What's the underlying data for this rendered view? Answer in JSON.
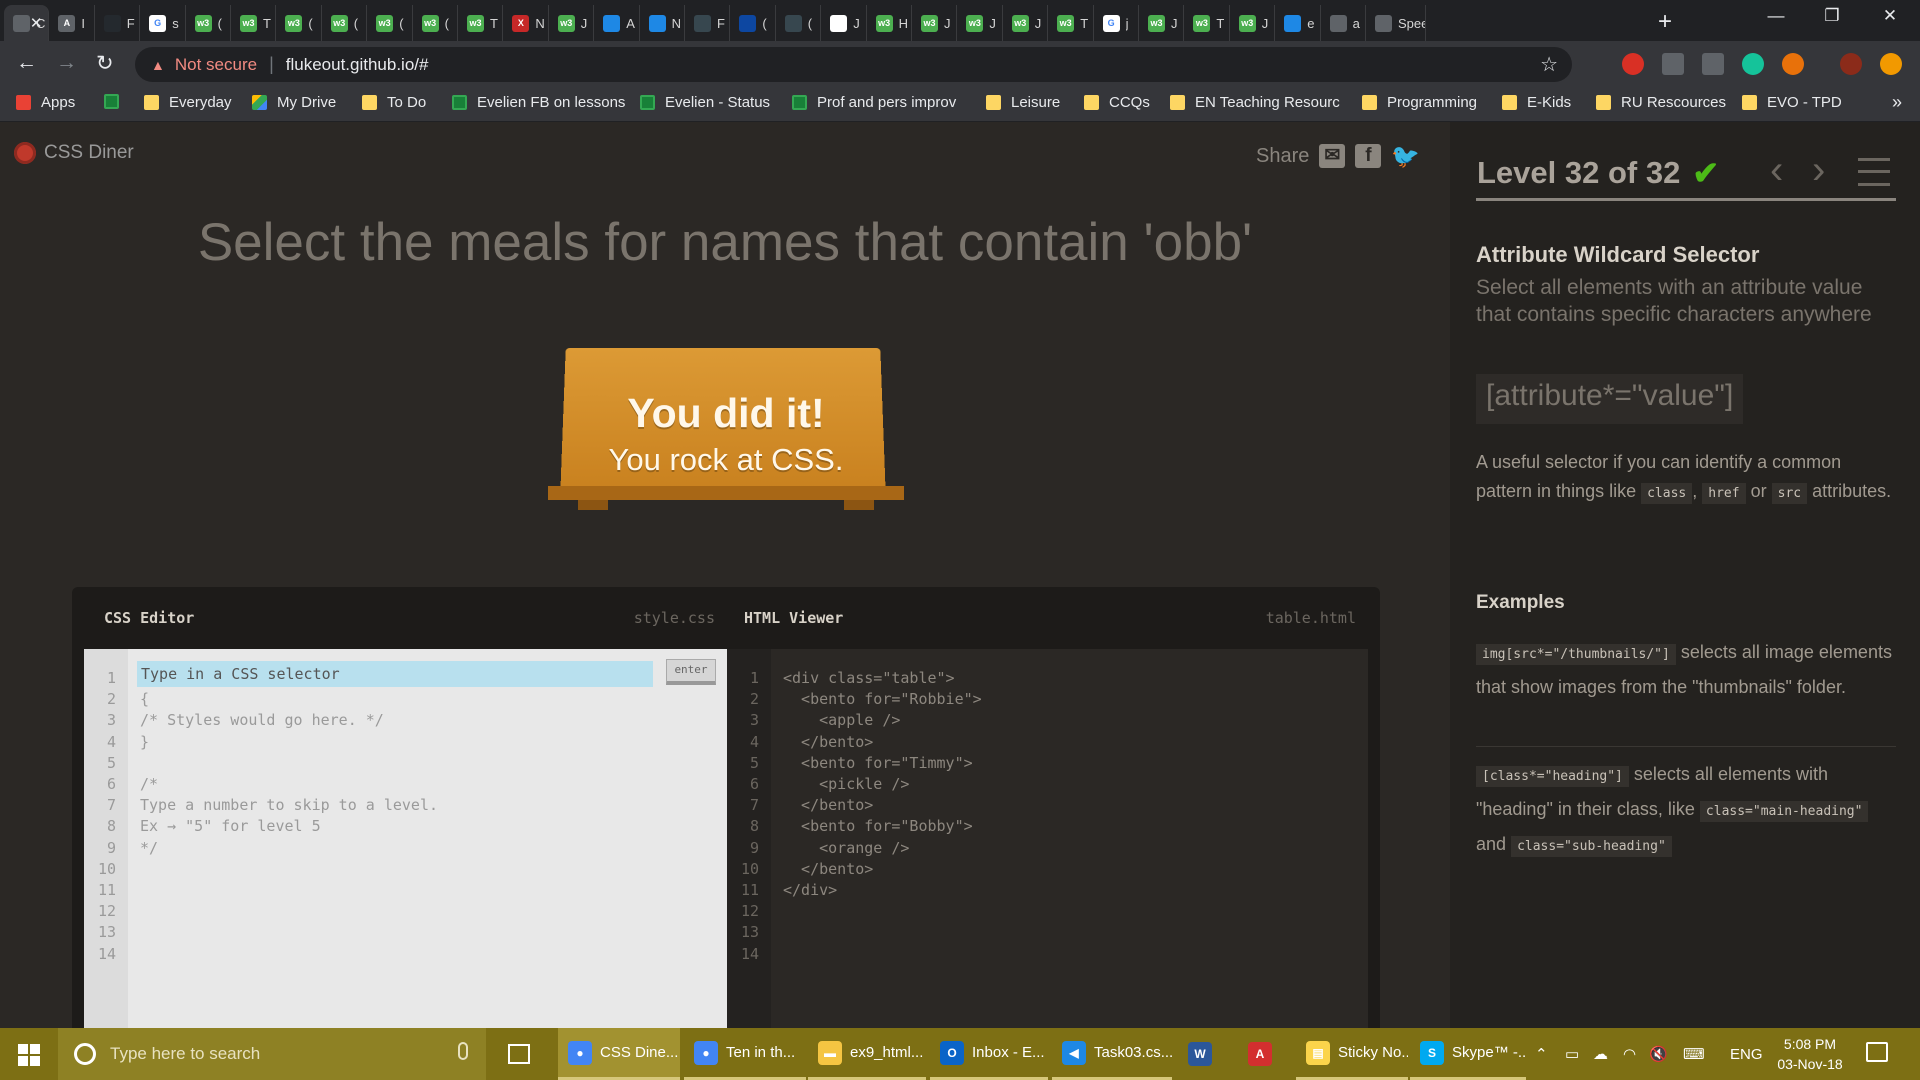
{
  "browser": {
    "tabs": [
      {
        "label": "C",
        "active": true,
        "color": "#5f6368",
        "glyph": ""
      },
      {
        "label": "I",
        "color": "#5f6368",
        "glyph": "A"
      },
      {
        "label": "F",
        "color": "#24292e",
        "glyph": ""
      },
      {
        "label": "s",
        "color": "#ffffff",
        "glyph": "G"
      },
      {
        "label": "(",
        "color": "#4caf50",
        "glyph": "w3"
      },
      {
        "label": "T",
        "color": "#4caf50",
        "glyph": "w3"
      },
      {
        "label": "(",
        "color": "#4caf50",
        "glyph": "w3"
      },
      {
        "label": "(",
        "color": "#4caf50",
        "glyph": "w3"
      },
      {
        "label": "(",
        "color": "#4caf50",
        "glyph": "w3"
      },
      {
        "label": "(",
        "color": "#4caf50",
        "glyph": "w3"
      },
      {
        "label": "T",
        "color": "#4caf50",
        "glyph": "w3"
      },
      {
        "label": "N",
        "color": "#c62828",
        "glyph": "X"
      },
      {
        "label": "J",
        "color": "#4caf50",
        "glyph": "w3"
      },
      {
        "label": "A",
        "color": "#1e88e5",
        "glyph": ""
      },
      {
        "label": "N",
        "color": "#1e88e5",
        "glyph": ""
      },
      {
        "label": "F",
        "color": "#37474f",
        "glyph": ""
      },
      {
        "label": "(",
        "color": "#0d47a1",
        "glyph": ""
      },
      {
        "label": "(",
        "color": "#37474f",
        "glyph": ""
      },
      {
        "label": "J",
        "color": "#ffffff",
        "glyph": ""
      },
      {
        "label": "H",
        "color": "#4caf50",
        "glyph": "w3"
      },
      {
        "label": "J",
        "color": "#4caf50",
        "glyph": "w3"
      },
      {
        "label": "J",
        "color": "#4caf50",
        "glyph": "w3"
      },
      {
        "label": "J",
        "color": "#4caf50",
        "glyph": "w3"
      },
      {
        "label": "T",
        "color": "#4caf50",
        "glyph": "w3"
      },
      {
        "label": "j",
        "color": "#ffffff",
        "glyph": "G"
      },
      {
        "label": "J",
        "color": "#4caf50",
        "glyph": "w3"
      },
      {
        "label": "T",
        "color": "#4caf50",
        "glyph": "w3"
      },
      {
        "label": "J",
        "color": "#4caf50",
        "glyph": "w3"
      },
      {
        "label": "e",
        "color": "#1e88e5",
        "glyph": ""
      },
      {
        "label": "a",
        "color": "#5f6368",
        "glyph": ""
      },
      {
        "label": "Spee",
        "color": "#5f6368",
        "glyph": ""
      }
    ],
    "omnibox": {
      "security_label": "Not secure",
      "url": "flukeout.github.io/#"
    },
    "bookmarks": [
      {
        "label": "Apps",
        "kind": "grid"
      },
      {
        "label": "",
        "kind": "sheet"
      },
      {
        "label": "Everyday",
        "kind": "folder"
      },
      {
        "label": "My Drive",
        "kind": "drive"
      },
      {
        "label": "To Do",
        "kind": "folder"
      },
      {
        "label": "Evelien FB on lessons",
        "kind": "sheet"
      },
      {
        "label": "Evelien - Status",
        "kind": "sheet"
      },
      {
        "label": "Prof and pers improv",
        "kind": "sheet"
      },
      {
        "label": "Leisure",
        "kind": "folder"
      },
      {
        "label": "CCQs",
        "kind": "folder"
      },
      {
        "label": "EN Teaching Resourc",
        "kind": "folder"
      },
      {
        "label": "Programming",
        "kind": "folder"
      },
      {
        "label": "E-Kids",
        "kind": "folder"
      },
      {
        "label": "RU Rescources",
        "kind": "folder"
      },
      {
        "label": "EVO - TPD",
        "kind": "folder"
      }
    ],
    "more_bookmarks": "»"
  },
  "app": {
    "logo_text": "CSS Diner",
    "share_label": "Share",
    "share_icons": [
      "email-icon",
      "facebook-icon",
      "twitter-icon"
    ],
    "order_text": "Select the meals for names that contain 'obb'",
    "win_title": "You did it!",
    "win_subtitle": "You rock at CSS.",
    "css_editor": {
      "title": "CSS Editor",
      "filename": "style.css",
      "placeholder": "Type in a CSS selector",
      "enter_label": "enter",
      "lines": [
        "{",
        "/* Styles would go here. */",
        "}",
        "",
        "/*",
        "Type a number to skip to a level.",
        "Ex → \"5\" for level 5",
        "*/",
        "",
        "",
        "",
        "",
        ""
      ],
      "line_numbers": [
        "1",
        "2",
        "3",
        "4",
        "5",
        "6",
        "7",
        "8",
        "9",
        "10",
        "11",
        "12",
        "13",
        "14"
      ]
    },
    "html_viewer": {
      "title": "HTML Viewer",
      "filename": "table.html",
      "lines": [
        "<div class=\"table\">",
        "  <bento for=\"Robbie\">",
        "    <apple />",
        "  </bento>",
        "  <bento for=\"Timmy\">",
        "    <pickle />",
        "  </bento>",
        "  <bento for=\"Bobby\">",
        "    <orange />",
        "  </bento>",
        "</div>",
        "",
        "",
        ""
      ],
      "line_numbers": [
        "1",
        "2",
        "3",
        "4",
        "5",
        "6",
        "7",
        "8",
        "9",
        "10",
        "11",
        "12",
        "13",
        "14"
      ]
    },
    "sidebar": {
      "level_text": "Level 32 of 32",
      "check": "✔",
      "progress_fraction": 1.0,
      "selector_name": "Attribute Wildcard Selector",
      "selector_title": "Select all elements with an attribute value that contains specific characters anywhere",
      "syntax": "[attribute*=\"value\"]",
      "hint": {
        "pre": "A useful selector if you can identify a common pattern in things like",
        "code1": "class",
        "sep1": ",",
        "code2": "href",
        "sep2": "or",
        "code3": "src",
        "post": "attributes."
      },
      "examples_title": "Examples",
      "example1": {
        "code": "img[src*=\"/thumbnails/\"]",
        "text": "selects all image elements that show images from the \"thumbnails\" folder."
      },
      "example2": {
        "code": "[class*=\"heading\"]",
        "text1": "selects all elements with \"heading\" in their class, like",
        "code2": "class=\"main-heading\"",
        "sep": "and",
        "code3": "class=\"sub-heading\""
      }
    }
  },
  "taskbar": {
    "search_placeholder": "Type here to search",
    "items": [
      {
        "label": "CSS Dine...",
        "icon": "chrome-icon",
        "color": "#4285f4",
        "active": true
      },
      {
        "label": "Ten in th...",
        "icon": "chrome-icon",
        "color": "#4285f4"
      },
      {
        "label": "ex9_html...",
        "icon": "folder-icon",
        "color": "#f5c542"
      },
      {
        "label": "Inbox - E...",
        "icon": "outlook-icon",
        "color": "#0a64c8"
      },
      {
        "label": "Task03.cs...",
        "icon": "vscode-icon",
        "color": "#1e88e5"
      },
      {
        "label": "",
        "icon": "word-icon",
        "color": "#2b579a"
      },
      {
        "label": "",
        "icon": "acrobat-icon",
        "color": "#d32f2f"
      },
      {
        "label": "Sticky No...",
        "icon": "sticky-notes-icon",
        "color": "#fbd44b"
      },
      {
        "label": "Skype™ -...",
        "icon": "skype-icon",
        "color": "#00a9f0"
      }
    ],
    "tray_lang": "ENG",
    "time": "5:08 PM",
    "date": "03-Nov-18"
  }
}
